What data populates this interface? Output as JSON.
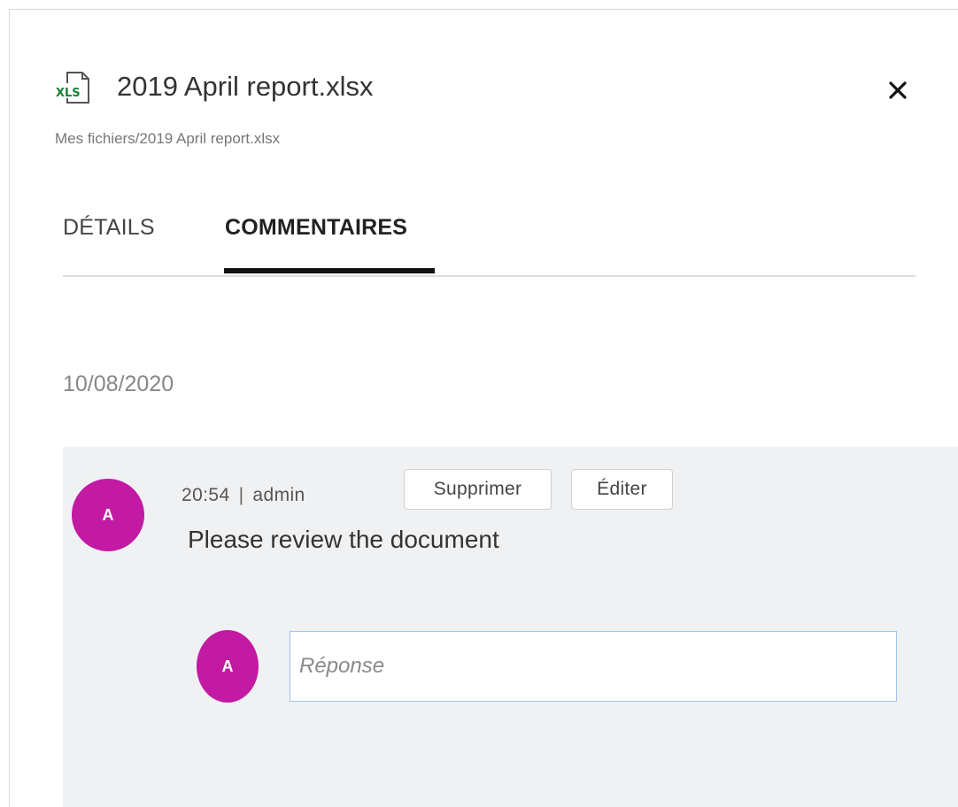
{
  "header": {
    "file_icon_label": "XLS",
    "file_name": "2019 April report.xlsx",
    "path": "Mes fichiers/2019 April report.xlsx",
    "close_glyph": "✕"
  },
  "tabs": [
    {
      "label": "DÉTAILS",
      "active": false
    },
    {
      "label": "COMMENTAIRES",
      "active": true
    }
  ],
  "comments": {
    "date": "10/08/2020",
    "items": [
      {
        "avatar_initial": "A",
        "time": "20:54",
        "separator": "|",
        "author": "admin",
        "delete_label": "Supprimer",
        "edit_label": "Éditer",
        "text": "Please review the document"
      }
    ],
    "reply": {
      "avatar_initial": "A",
      "placeholder": "Réponse",
      "value": ""
    }
  },
  "colors": {
    "avatar": "#c21aa3",
    "panel_bg": "#f0f1f3",
    "excel_green": "#1e7e34",
    "input_border": "#9ec4ee"
  },
  "icons": {
    "file": "xls-file-icon",
    "close": "close-icon"
  }
}
